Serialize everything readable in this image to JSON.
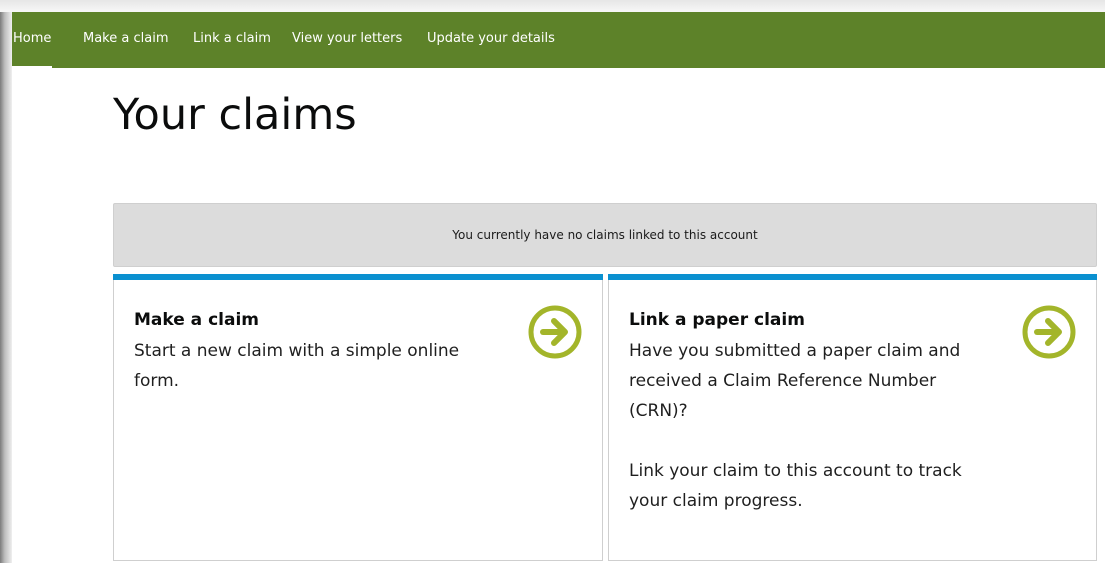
{
  "nav": {
    "items": [
      {
        "label": "Home"
      },
      {
        "label": "Make a claim"
      },
      {
        "label": "Link a claim"
      },
      {
        "label": "View your letters"
      },
      {
        "label": "Update your details"
      }
    ]
  },
  "page": {
    "title": "Your claims",
    "notice": "You currently have no claims linked to this account"
  },
  "cards": [
    {
      "title": "Make a claim",
      "paragraphs": [
        "Start a new claim with a simple online form."
      ]
    },
    {
      "title": "Link a paper claim",
      "paragraphs": [
        "Have you submitted a paper claim and received a Claim Reference Number (CRN)?",
        "Link your claim to this account to track your claim progress."
      ]
    }
  ],
  "colors": {
    "nav_bg": "#5d8229",
    "card_accent": "#0a90d0",
    "arrow": "#a3b52a",
    "notice_bg": "#dcdcdc"
  },
  "icons": {
    "card_action": "arrow-right-circle-icon"
  }
}
